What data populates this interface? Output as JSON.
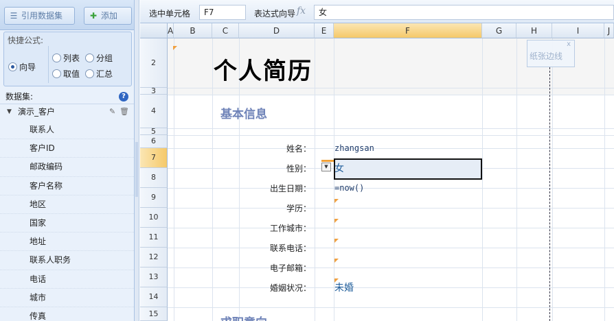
{
  "left_panel": {
    "ref_dataset_button": "引用数据集",
    "add_button": "添加",
    "quick_formula_title": "快捷公式:",
    "options": {
      "guide": "向导",
      "list": "列表",
      "group": "分组",
      "value": "取值",
      "summary": "汇总"
    },
    "selected_option": "向导",
    "dataset_title": "数据集:",
    "dataset_name": "演示_客户",
    "fields": [
      "联系人",
      "客户ID",
      "邮政编码",
      "客户名称",
      "地区",
      "国家",
      "地址",
      "联系人职务",
      "电话",
      "城市",
      "传真"
    ]
  },
  "formula_bar": {
    "cell_label": "选中单元格",
    "cell_ref": "F7",
    "expr_label": "表达式向导",
    "fx": "fx",
    "expr_value": "女"
  },
  "sheet": {
    "columns": [
      "A",
      "B",
      "C",
      "D",
      "E",
      "F",
      "G",
      "H",
      "I",
      "J"
    ],
    "selected_column": "F",
    "rows": [
      "2",
      "3",
      "4",
      "5",
      "6",
      "7",
      "8",
      "9",
      "10",
      "11",
      "12",
      "13",
      "14",
      "15"
    ],
    "selected_row": "7",
    "title": "个人简历",
    "section_basic": "基本信息",
    "section_job": "求职意向",
    "labels": {
      "name": "姓名：",
      "gender": "性别：",
      "birth": "出生日期：",
      "edu": "学历：",
      "city": "工作城市：",
      "phone": "联系电话：",
      "email": "电子邮箱：",
      "marital": "婚姻状况："
    },
    "values": {
      "name": "zhangsan",
      "gender": "女",
      "birth": "=now()",
      "marital": "未婚"
    },
    "margin_tip": "纸张边线",
    "margin_close": "x"
  }
}
